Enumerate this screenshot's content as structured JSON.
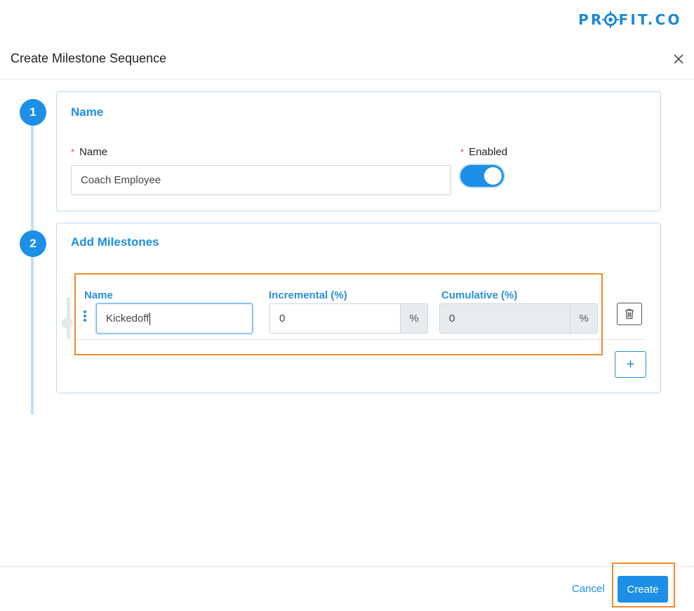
{
  "brand": {
    "logo_text_left": "PR",
    "logo_text_right": "FIT.CO"
  },
  "modal": {
    "title": "Create Milestone Sequence",
    "close_icon": "close-icon"
  },
  "steps": [
    {
      "number": "1",
      "title": "Name"
    },
    {
      "number": "2",
      "title": "Add Milestones"
    }
  ],
  "name_section": {
    "name_label": "Name",
    "name_value": "Coach Employee",
    "enabled_label": "Enabled",
    "required_marker": "*",
    "enabled": true
  },
  "milestones": {
    "columns": {
      "name": "Name",
      "incremental": "Incremental (%)",
      "cumulative": "Cumulative (%)"
    },
    "rows": [
      {
        "name": "Kickedoff",
        "incremental": "0",
        "incremental_unit": "%",
        "cumulative": "0",
        "cumulative_unit": "%"
      }
    ],
    "delete_icon": "trash-icon",
    "add_button_label": "+"
  },
  "footer": {
    "cancel_label": "Cancel",
    "create_label": "Create"
  },
  "colors": {
    "primary": "#1d8fe6",
    "highlight": "#f28a2c",
    "required": "#d9534f"
  }
}
